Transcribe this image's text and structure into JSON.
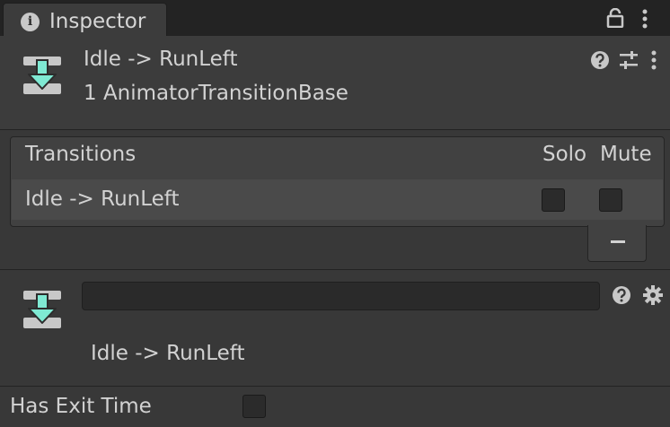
{
  "tab": {
    "title": "Inspector"
  },
  "header": {
    "title": "Idle -> RunLeft",
    "subtitle": "1 AnimatorTransitionBase"
  },
  "transitions": {
    "columns": {
      "name": "Transitions",
      "solo": "Solo",
      "mute": "Mute"
    },
    "rows": [
      {
        "name": "Idle -> RunLeft",
        "solo": false,
        "mute": false
      }
    ],
    "remove_label": "−"
  },
  "detail": {
    "name_field_value": "",
    "title": "Idle -> RunLeft"
  },
  "settings": {
    "has_exit_time_label": "Has Exit Time",
    "has_exit_time": false
  },
  "colors": {
    "accent_arrow": "#7fe9d3",
    "icon_gray": "#c8c8c8",
    "panel_bg": "#383838"
  }
}
